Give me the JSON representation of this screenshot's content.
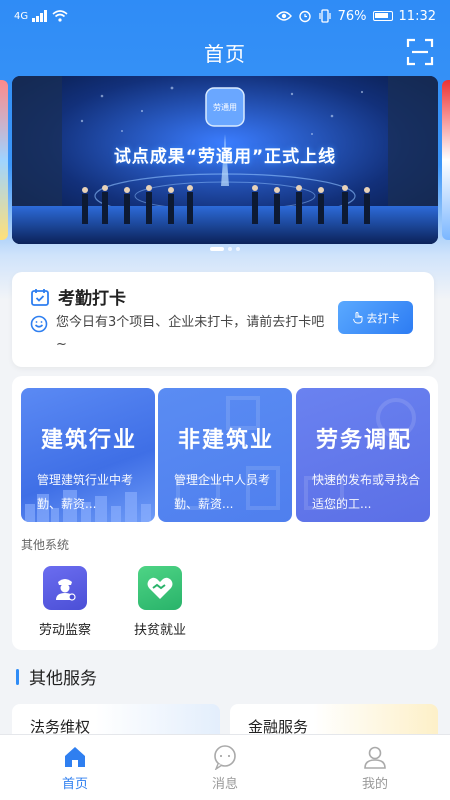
{
  "status_bar": {
    "network": "4G",
    "battery": "76%",
    "time": "11:32"
  },
  "nav": {
    "title": "首页"
  },
  "banner": {
    "headline": "试点成果“劳通用”正式上线",
    "badge": "劳通用"
  },
  "attendance": {
    "title": "考勤打卡",
    "message": "您今日有3个项目、企业未打卡，请前去打卡吧~",
    "button": "去打卡"
  },
  "systems": {
    "tiles": [
      {
        "title": "建筑行业",
        "desc": "管理建筑行业中考勤、薪资..."
      },
      {
        "title": "非建筑业",
        "desc": "管理企业中人员考勤、薪资..."
      },
      {
        "title": "劳务调配",
        "desc": "快速的发布或寻找合适您的工..."
      }
    ],
    "other_label": "其他系统",
    "apps": [
      {
        "label": "劳动监察"
      },
      {
        "label": "扶贫就业"
      }
    ]
  },
  "services": {
    "title": "其他服务",
    "items": [
      {
        "label": "法务维权"
      },
      {
        "label": "金融服务"
      }
    ]
  },
  "tabs": [
    {
      "label": "首页"
    },
    {
      "label": "消息"
    },
    {
      "label": "我的"
    }
  ]
}
